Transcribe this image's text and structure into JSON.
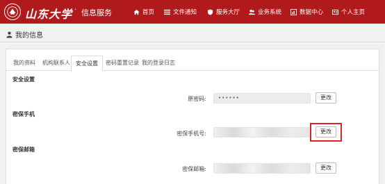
{
  "header": {
    "brand_name": "山东大学",
    "brand_separator": "·",
    "brand_sub": "信息服务",
    "nav": [
      {
        "label": "首页",
        "icon": "home-icon"
      },
      {
        "label": "文件通知",
        "icon": "list-icon"
      },
      {
        "label": "服务大厅",
        "icon": "shield-icon"
      },
      {
        "label": "业务系统",
        "icon": "users-icon"
      },
      {
        "label": "数据中心",
        "icon": "chart-icon"
      },
      {
        "label": "个人主页",
        "icon": "profile-card-icon"
      }
    ]
  },
  "page": {
    "title": "我的信息",
    "title_icon": "user-icon"
  },
  "tabs": [
    {
      "label": "我的资料",
      "active": false
    },
    {
      "label": "机构联系人",
      "active": false
    },
    {
      "label": "安全设置",
      "active": true
    },
    {
      "label": "密码重置记录",
      "active": false
    },
    {
      "label": "我的登录日志",
      "active": false
    }
  ],
  "sections": {
    "security": {
      "title": "安全设置",
      "password_label": "原密码:",
      "password_value": "••••••",
      "change_button": "更改"
    },
    "phone": {
      "title": "密保手机",
      "phone_label": "密保手机号:",
      "change_button": "更改"
    },
    "email": {
      "title": "密保邮箱",
      "email_label": "密保邮箱:",
      "change_button": "更改"
    }
  },
  "colors": {
    "header_bg": "#b11a1d",
    "highlight_border": "#d9242a"
  }
}
